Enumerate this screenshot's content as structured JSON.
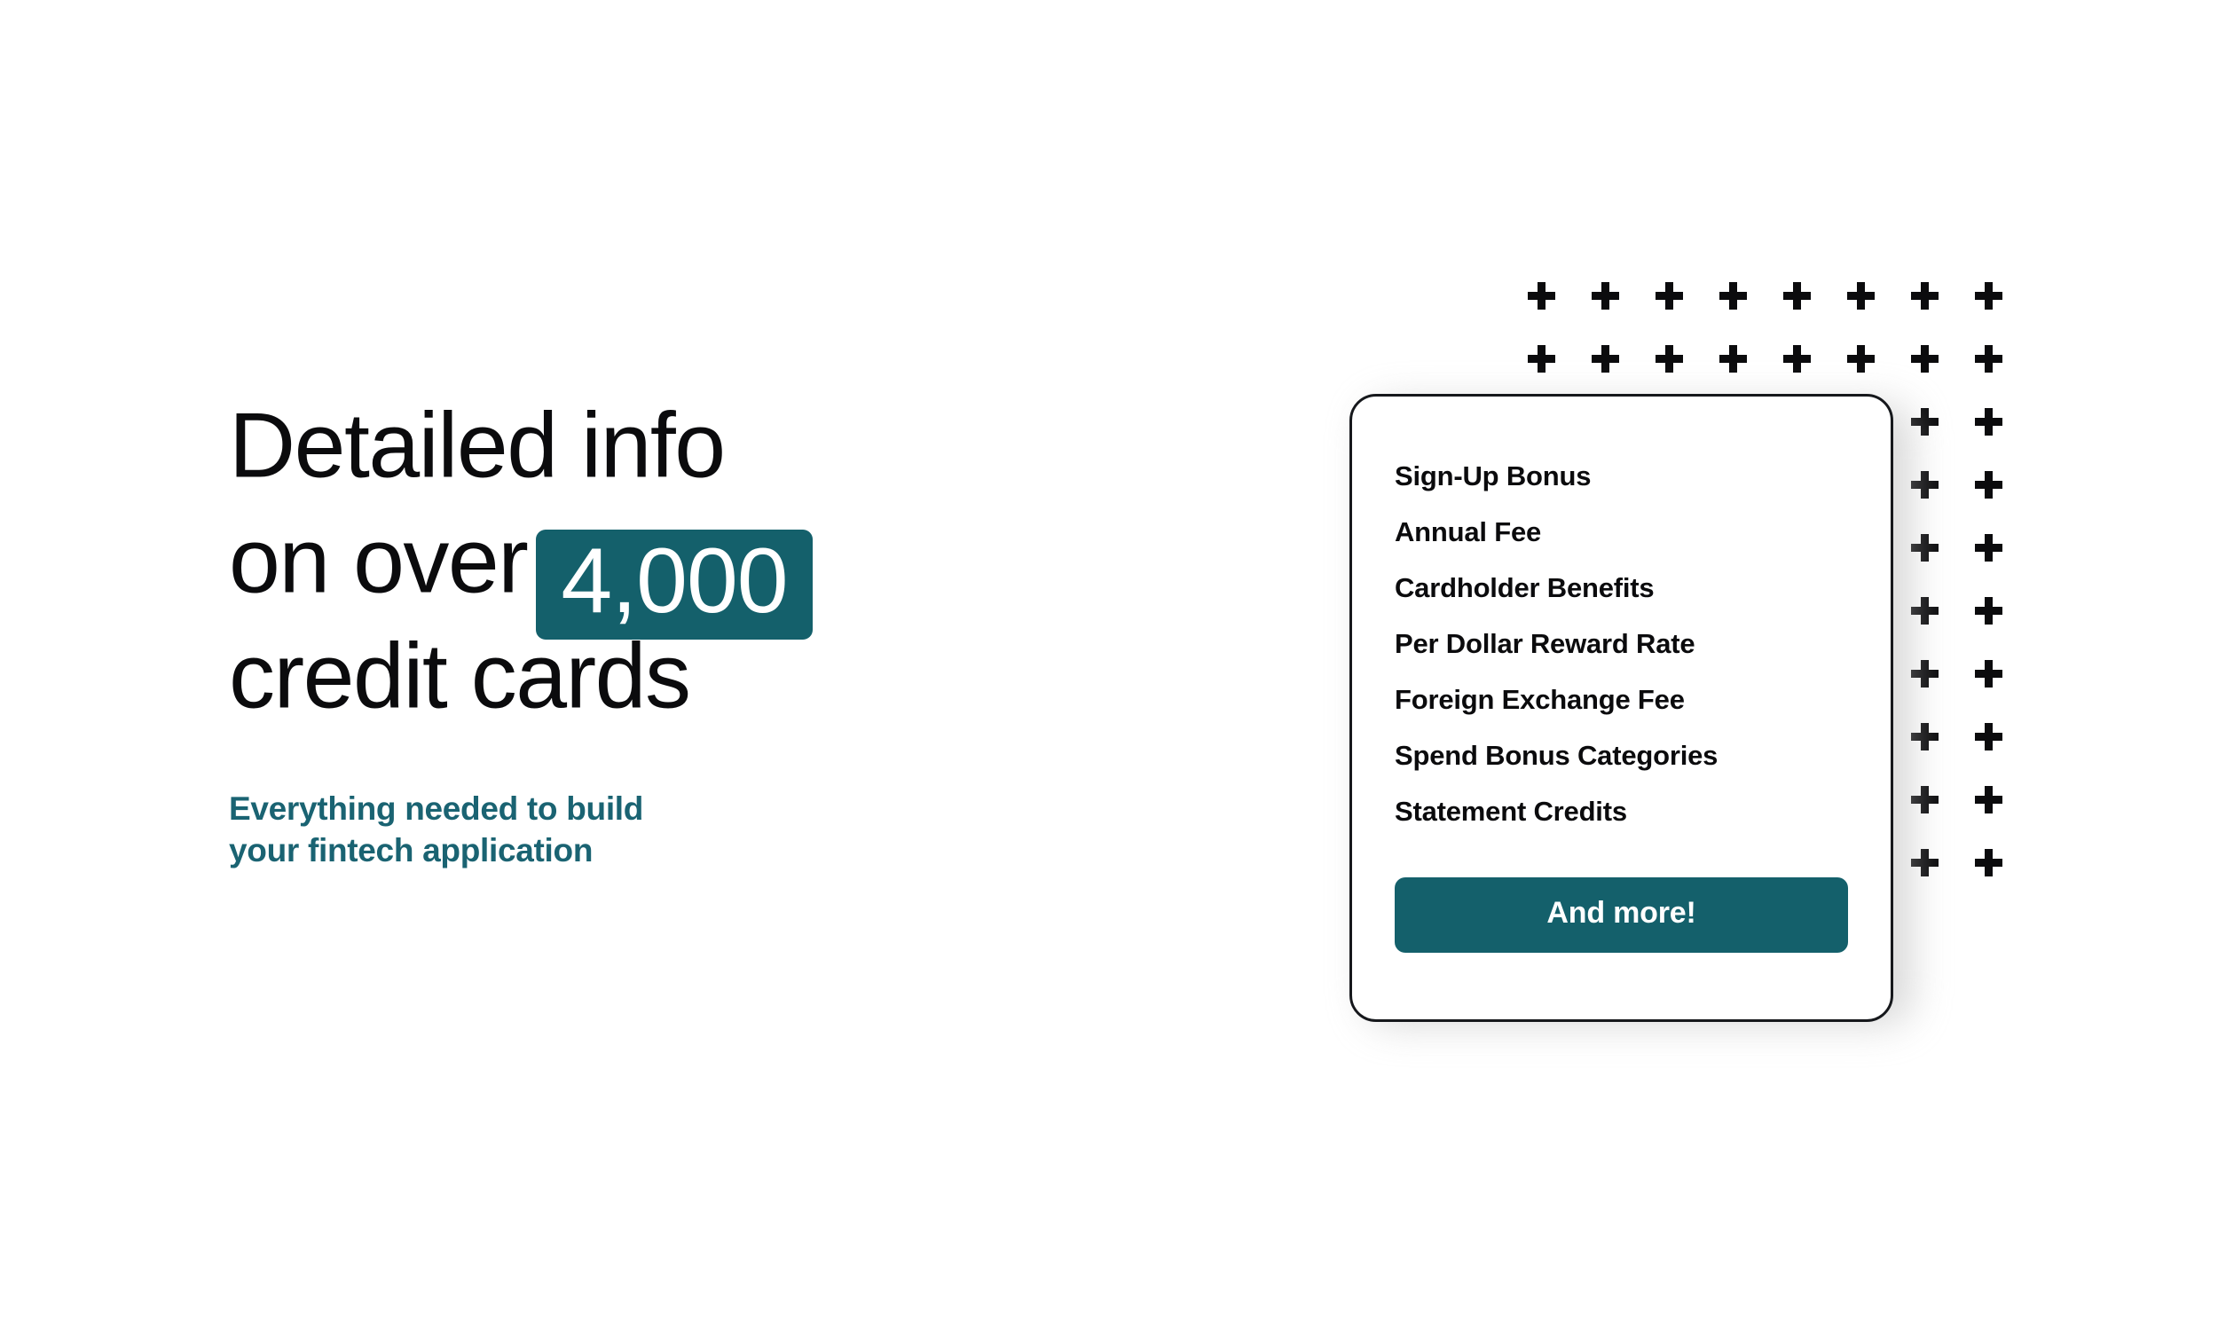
{
  "hero": {
    "headline": {
      "line1": "Detailed info",
      "line2_prefix": "on over",
      "badge_value": "4,000",
      "line3": "credit cards"
    },
    "subhead": {
      "line1": "Everything needed to build",
      "line2": "your fintech application"
    }
  },
  "card": {
    "features": [
      "Sign-Up Bonus",
      "Annual Fee",
      "Cardholder Benefits",
      "Per Dollar Reward Rate",
      "Foreign Exchange Fee",
      "Spend Bonus Categories",
      "Statement Credits"
    ],
    "cta_label": "And more!"
  },
  "decoration": {
    "plus_icon_name": "plus-icon",
    "grid_columns": 8,
    "grid_rows": 10
  },
  "colors": {
    "accent_teal": "#14606b",
    "subhead_teal": "#1a6372",
    "text_black": "#0b0b0d",
    "background": "#ffffff",
    "card_border": "#16181c"
  }
}
